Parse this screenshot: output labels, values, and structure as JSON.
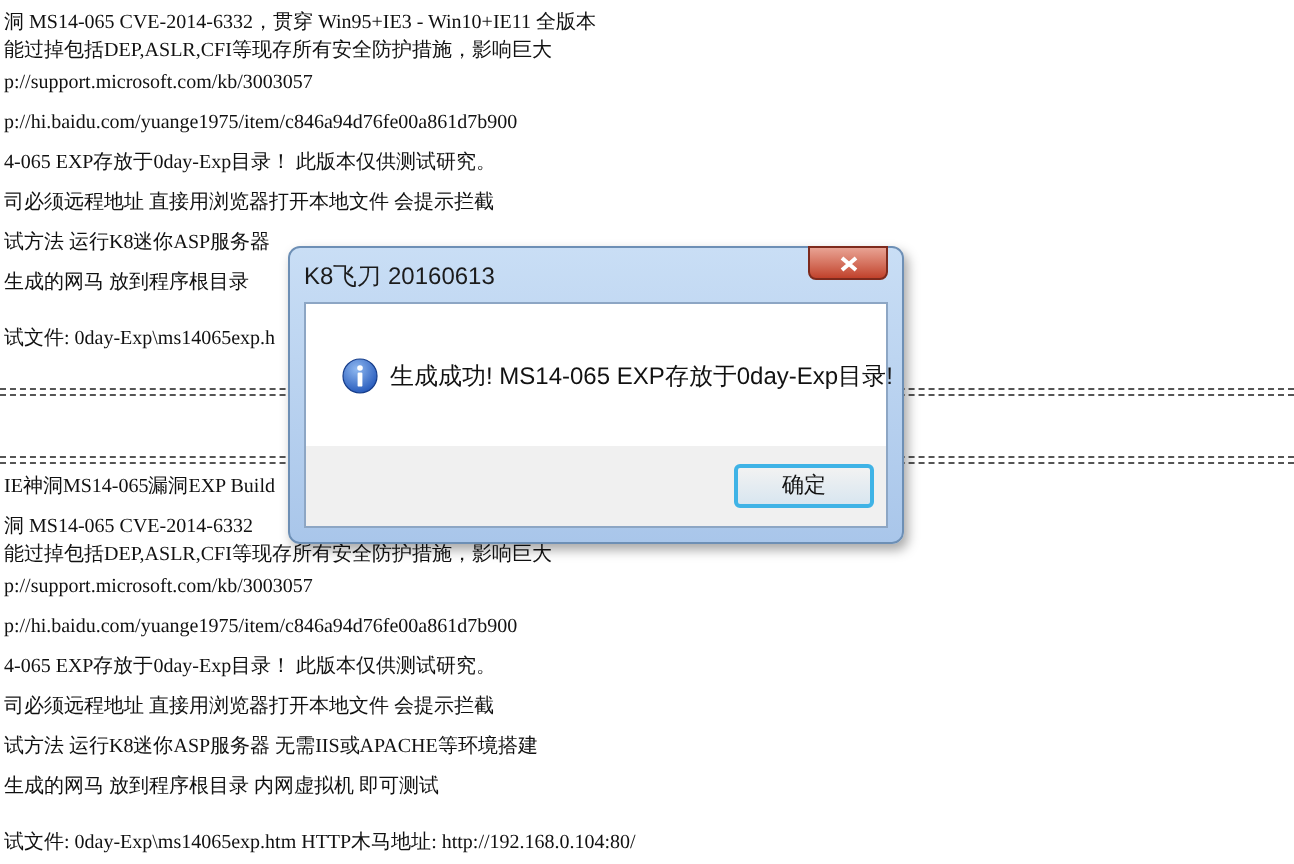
{
  "document": {
    "lines": [
      {
        "kind": "text",
        "text": "洞  MS14-065  CVE-2014-6332，贯穿 Win95+IE3 - Win10+IE11 全版本"
      },
      {
        "kind": "continuation",
        "text": "能过掉包括DEP,ASLR,CFI等现存所有安全防护措施，影响巨大"
      },
      {
        "kind": "text",
        "text": "p://support.microsoft.com/kb/3003057"
      },
      {
        "kind": "text",
        "text": "p://hi.baidu.com/yuange1975/item/c846a94d76fe00a861d7b900"
      },
      {
        "kind": "text",
        "text": "4-065 EXP存放于0day-Exp目录！ 此版本仅供测试研究。"
      },
      {
        "kind": "text",
        "text": "司必须远程地址 直接用浏览器打开本地文件 会提示拦截"
      },
      {
        "kind": "text",
        "text": "试方法 运行K8迷你ASP服务器"
      },
      {
        "kind": "text",
        "text": "生成的网马 放到程序根目录"
      },
      {
        "kind": "spaced",
        "text": "试文件: 0day-Exp\\ms14065exp.h"
      },
      {
        "kind": "rule"
      },
      {
        "kind": "rule"
      },
      {
        "kind": "text",
        "text": "IE神洞MS14-065漏洞EXP   Build"
      },
      {
        "kind": "text",
        "text": "洞  MS14-065  CVE-2014-6332"
      },
      {
        "kind": "continuation",
        "text": "能过掉包括DEP,ASLR,CFI等现存所有安全防护措施，影响巨大"
      },
      {
        "kind": "text",
        "text": "p://support.microsoft.com/kb/3003057"
      },
      {
        "kind": "text",
        "text": "p://hi.baidu.com/yuange1975/item/c846a94d76fe00a861d7b900"
      },
      {
        "kind": "text",
        "text": "4-065 EXP存放于0day-Exp目录！ 此版本仅供测试研究。"
      },
      {
        "kind": "text",
        "text": "司必须远程地址 直接用浏览器打开本地文件 会提示拦截"
      },
      {
        "kind": "text",
        "text": "试方法 运行K8迷你ASP服务器 无需IIS或APACHE等环境搭建"
      },
      {
        "kind": "text",
        "text": "生成的网马 放到程序根目录   内网虚拟机 即可测试"
      },
      {
        "kind": "spaced",
        "text": "试文件: 0day-Exp\\ms14065exp.htm  HTTP木马地址: http://192.168.0.104:80/"
      }
    ]
  },
  "dialog": {
    "title": "K8飞刀 20160613",
    "message": "生成成功! MS14-065 EXP存放于0day-Exp目录!",
    "buttons": [
      {
        "label": "确定",
        "focused": true
      }
    ]
  }
}
